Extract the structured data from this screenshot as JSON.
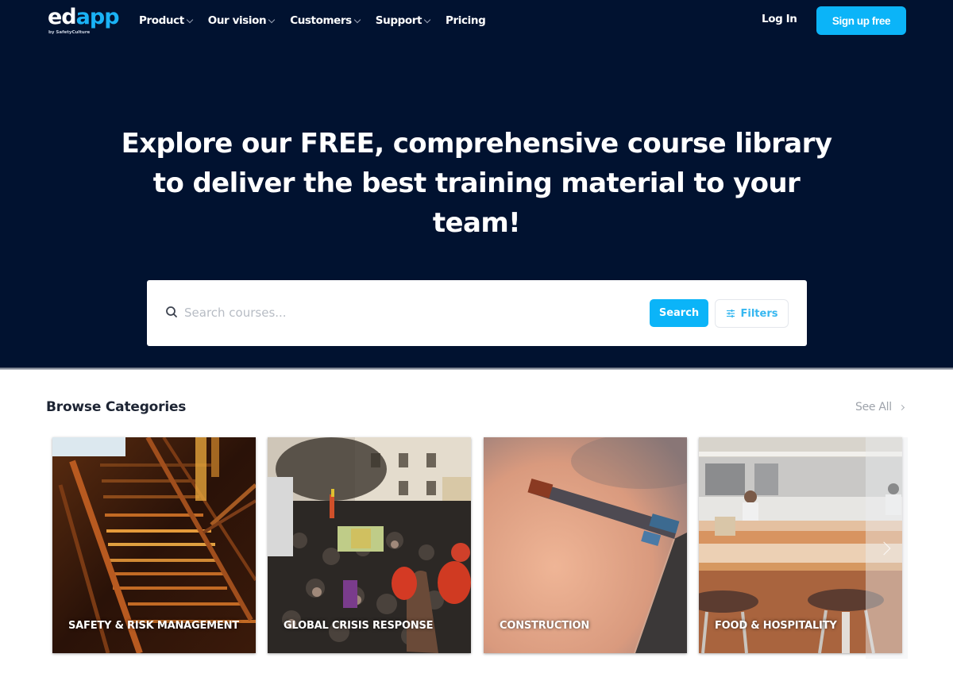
{
  "nav": {
    "logo": {
      "ed": "ed",
      "app": "app",
      "subtitle": "by SafetyCulture"
    },
    "menu": [
      {
        "label": "Product",
        "has_dropdown": true
      },
      {
        "label": "Our vision",
        "has_dropdown": true
      },
      {
        "label": "Customers",
        "has_dropdown": true
      },
      {
        "label": "Support",
        "has_dropdown": true
      },
      {
        "label": "Pricing",
        "has_dropdown": false
      }
    ],
    "login_label": "Log In",
    "signup_label": "Sign up free"
  },
  "hero": {
    "title": "Explore our FREE, comprehensive course library to deliver the best training material to your team!"
  },
  "search": {
    "placeholder": "Search courses...",
    "value": "",
    "search_button_label": "Search",
    "filters_button_label": "Filters"
  },
  "browse": {
    "title": "Browse Categories",
    "see_all_label": "See All",
    "categories": [
      {
        "label": "SAFETY & RISK MANAGEMENT",
        "image": "stairs-photo"
      },
      {
        "label": "GLOBAL CRISIS RESPONSE",
        "image": "crowd-photo"
      },
      {
        "label": "CONSTRUCTION",
        "image": "crane-photo"
      },
      {
        "label": "FOOD & HOSPITALITY",
        "image": "cafe-photo"
      }
    ]
  },
  "colors": {
    "hero_bg": "#011230",
    "brand_blue": "#0bb4f8",
    "logo_blue": "#1ab2f5"
  }
}
